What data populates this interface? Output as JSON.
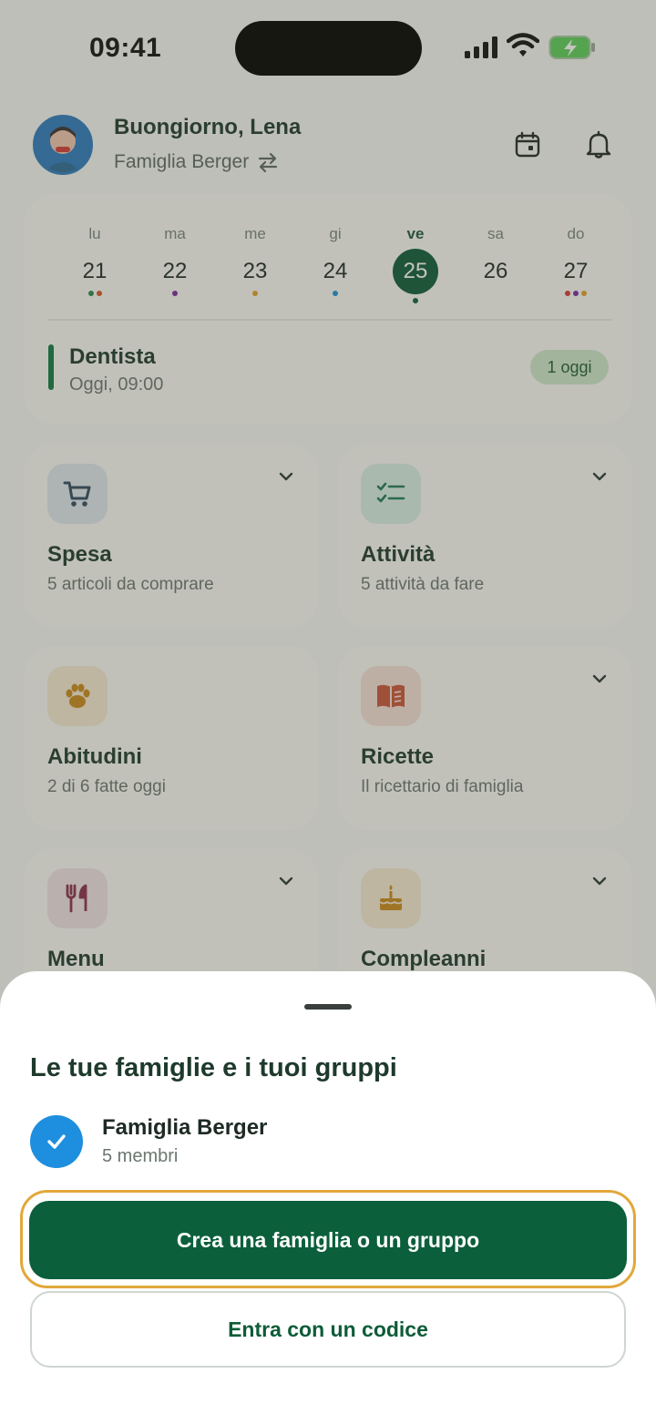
{
  "status_bar": {
    "time": "09:41"
  },
  "header": {
    "greeting": "Buongiorno, Lena",
    "family": "Famiglia Berger"
  },
  "calendar": {
    "days": [
      {
        "name": "lu",
        "num": "21",
        "dots": [
          "#2a8a4a",
          "#d8542b"
        ]
      },
      {
        "name": "ma",
        "num": "22",
        "dots": [
          "#7b2aa8"
        ]
      },
      {
        "name": "me",
        "num": "23",
        "dots": [
          "#e2a12a"
        ]
      },
      {
        "name": "gi",
        "num": "24",
        "dots": [
          "#1e8fdf"
        ]
      },
      {
        "name": "ve",
        "num": "25",
        "dots": [
          "#0b5f3b"
        ]
      },
      {
        "name": "sa",
        "num": "26",
        "dots": []
      },
      {
        "name": "do",
        "num": "27",
        "dots": [
          "#d43a3a",
          "#7b2aa8",
          "#e2a12a"
        ]
      }
    ],
    "active_index": 4,
    "event": {
      "title": "Dentista",
      "time": "Oggi, 09:00",
      "badge": "1 oggi"
    }
  },
  "tiles": [
    {
      "title": "Spesa",
      "subtitle": "5 articoli da comprare",
      "icon": "cart-icon",
      "icon_bg": "#dfe8ef"
    },
    {
      "title": "Attività",
      "subtitle": "5 attività da fare",
      "icon": "checklist-icon",
      "icon_bg": "#d9efe6"
    },
    {
      "title": "Abitudini",
      "subtitle": "2 di 6 fatte oggi",
      "icon": "paw-icon",
      "icon_bg": "#f6ead5"
    },
    {
      "title": "Ricette",
      "subtitle": "Il ricettario di famiglia",
      "icon": "book-icon",
      "icon_bg": "#f6e0d9"
    },
    {
      "title": "Menu",
      "subtitle": "",
      "icon": "cutlery-icon",
      "icon_bg": "#f1e2e6"
    },
    {
      "title": "Compleanni",
      "subtitle": "",
      "icon": "cake-icon",
      "icon_bg": "#f6ead5"
    }
  ],
  "sheet": {
    "title": "Le tue famiglie e i tuoi gruppi",
    "family": {
      "name": "Famiglia Berger",
      "members": "5 membri"
    },
    "primary_button": "Crea una famiglia o un gruppo",
    "secondary_button": "Entra con un codice"
  },
  "colors": {
    "brand_green": "#0b5f3b",
    "selection_blue": "#1e8fdf",
    "focus_ring": "#e2a83b"
  }
}
